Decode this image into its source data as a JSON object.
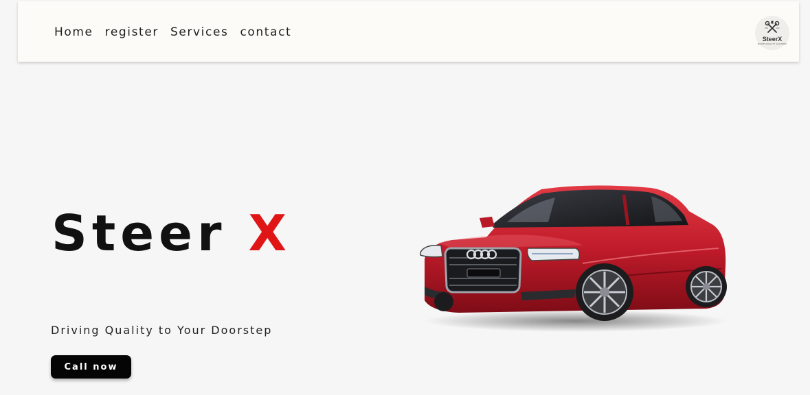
{
  "nav": {
    "links": [
      "Home",
      "register",
      "Services",
      "contact"
    ]
  },
  "logo": {
    "icon": "crossed-wrenches-icon",
    "name": "SteerX",
    "est_left": "EST",
    "est_right": "2023",
    "subtitle": "DRIVE QUALITY LOCATED"
  },
  "hero": {
    "title_main": "Steer",
    "title_accent": "X",
    "tagline": "Driving Quality to Your Doorstep",
    "cta_label": "Call now",
    "image": "red-sedan-car-image"
  },
  "colors": {
    "accent": "#e01515",
    "background": "#f6f6f6",
    "navbar": "#fdfbf7",
    "button": "#050505"
  }
}
